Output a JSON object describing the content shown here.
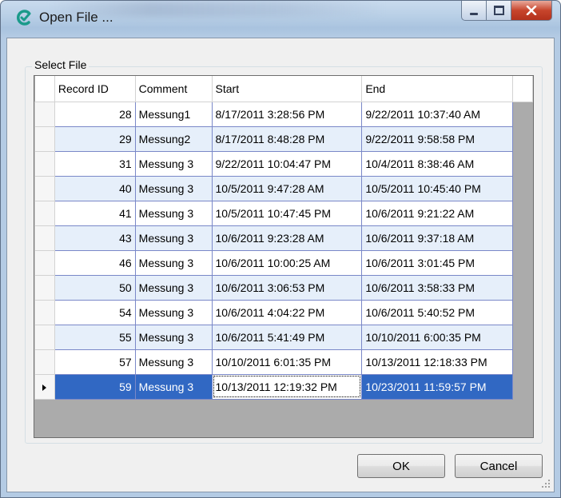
{
  "window": {
    "title": "Open File ..."
  },
  "group": {
    "label": "Select File"
  },
  "grid": {
    "columns": [
      "Record ID",
      "Comment",
      "Start",
      "End"
    ],
    "rows": [
      {
        "id": "28",
        "comment": "Messung1",
        "start": "8/17/2011 3:28:56 PM",
        "end": "9/22/2011 10:37:40 AM"
      },
      {
        "id": "29",
        "comment": "Messung2",
        "start": "8/17/2011 8:48:28 PM",
        "end": "9/22/2011 9:58:58 PM"
      },
      {
        "id": "31",
        "comment": "Messung 3",
        "start": "9/22/2011 10:04:47 PM",
        "end": "10/4/2011 8:38:46 AM"
      },
      {
        "id": "40",
        "comment": "Messung 3",
        "start": "10/5/2011 9:47:28 AM",
        "end": "10/5/2011 10:45:40 PM"
      },
      {
        "id": "41",
        "comment": "Messung 3",
        "start": "10/5/2011 10:47:45 PM",
        "end": "10/6/2011 9:21:22 AM"
      },
      {
        "id": "43",
        "comment": "Messung 3",
        "start": "10/6/2011 9:23:28 AM",
        "end": "10/6/2011 9:37:18 AM"
      },
      {
        "id": "46",
        "comment": "Messung 3",
        "start": "10/6/2011 10:00:25 AM",
        "end": "10/6/2011 3:01:45 PM"
      },
      {
        "id": "50",
        "comment": "Messung 3",
        "start": "10/6/2011 3:06:53 PM",
        "end": "10/6/2011 3:58:33 PM"
      },
      {
        "id": "54",
        "comment": "Messung 3",
        "start": "10/6/2011 4:04:22 PM",
        "end": "10/6/2011 5:40:52 PM"
      },
      {
        "id": "55",
        "comment": "Messung 3",
        "start": "10/6/2011 5:41:49 PM",
        "end": "10/10/2011 6:00:35 PM"
      },
      {
        "id": "57",
        "comment": "Messung 3",
        "start": "10/10/2011 6:01:35 PM",
        "end": "10/13/2011 12:18:33 PM"
      },
      {
        "id": "59",
        "comment": "Messung 3",
        "start": "10/13/2011 12:19:32 PM",
        "end": "10/23/2011 11:59:57 PM",
        "selected": true
      }
    ]
  },
  "buttons": {
    "ok": "OK",
    "cancel": "Cancel"
  },
  "icons": {
    "app": "app-logo-icon",
    "minimize": "minimize-icon",
    "maximize": "maximize-icon",
    "close": "close-icon",
    "current_row": "row-pointer-icon",
    "resize": "resize-grip-icon"
  },
  "colors": {
    "selection": "#3168c3",
    "alt_row": "#e6effa",
    "grid_line": "#7a88c8",
    "close_button": "#c7452c"
  }
}
